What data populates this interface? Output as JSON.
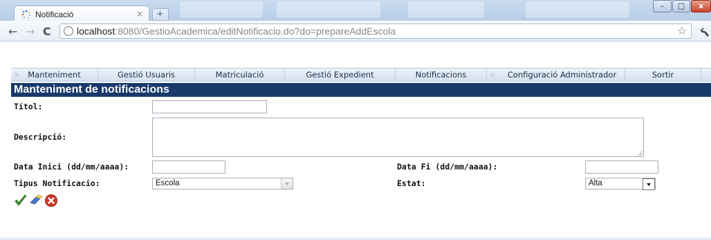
{
  "browser": {
    "tab_title": "Notificació",
    "tab_close": "×",
    "new_tab": "+",
    "url_host": "localhost",
    "url_rest": ":8080/GestioAcademica/editNotificacio.do?do=prepareAddEscola",
    "back_glyph": "←",
    "forward_glyph": "→",
    "reload_glyph": "C",
    "star_glyph": "☆",
    "window_buttons": {
      "minimize": "–",
      "maximize": "□",
      "close": "x"
    }
  },
  "menu": {
    "items": [
      {
        "label": "Manteniment",
        "arrow": true
      },
      {
        "label": "Gestió Usuaris",
        "arrow": false
      },
      {
        "label": "Matriculació",
        "arrow": false
      },
      {
        "label": "Gestió Expedient",
        "arrow": false
      },
      {
        "label": "Notificacions",
        "arrow": false
      },
      {
        "label": "Configuració Administrador",
        "arrow": true
      },
      {
        "label": "Sortir",
        "arrow": false
      }
    ]
  },
  "page": {
    "title": "Manteniment de notificacions"
  },
  "form": {
    "titol_label": "Títol:",
    "titol_value": "",
    "descripcio_label": "Descripció:",
    "descripcio_value": "",
    "data_inici_label": "Data Inici (dd/mm/aaaa):",
    "data_inici_value": "",
    "data_fi_label": "Data Fi (dd/mm/aaaa):",
    "data_fi_value": "",
    "tipus_label": "Tipus Notificacio:",
    "tipus_value": "Escola",
    "estat_label": "Estat:",
    "estat_value": "Alta"
  },
  "actions": {
    "accept_icon": "check-icon",
    "clear_icon": "eraser-icon",
    "cancel_icon": "cancel-icon"
  },
  "colors": {
    "title_bar": "#193a6b",
    "menu_text": "#1e2e46"
  }
}
